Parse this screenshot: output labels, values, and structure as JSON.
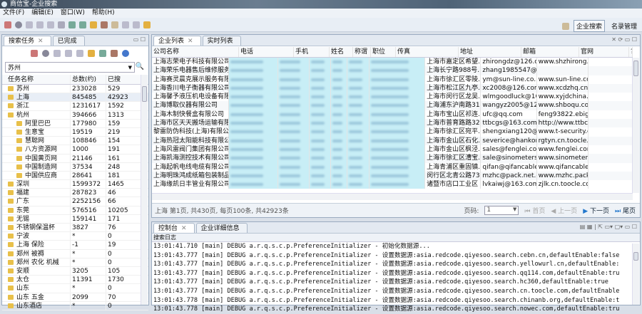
{
  "window": {
    "title": "商信宝-企业搜索"
  },
  "menu": [
    "文件(F)",
    "编辑(E)",
    "窗口(W)",
    "帮助(H)"
  ],
  "perspectives": {
    "search": "企业搜索",
    "list": "名录管理"
  },
  "left": {
    "tabs": [
      "搜索任务",
      "已完成"
    ],
    "search_value": "苏州",
    "columns": [
      "任务名称",
      "总数(约)",
      "已搜"
    ],
    "rows": [
      {
        "name": "苏州",
        "total": "233028",
        "done": "529",
        "sub": false
      },
      {
        "name": "上海",
        "total": "845485",
        "done": "42923",
        "sub": false
      },
      {
        "name": "浙江",
        "total": "1231617",
        "done": "1592",
        "sub": false
      },
      {
        "name": "杭州",
        "total": "394666",
        "done": "1313",
        "sub": false
      },
      {
        "name": "阿里巴巴",
        "total": "177980",
        "done": "159",
        "sub": true
      },
      {
        "name": "生意宝",
        "total": "19519",
        "done": "219",
        "sub": true
      },
      {
        "name": "慧聪网",
        "total": "108846",
        "done": "154",
        "sub": true
      },
      {
        "name": "八方资源网",
        "total": "1000",
        "done": "191",
        "sub": true
      },
      {
        "name": "中国黄页网",
        "total": "21146",
        "done": "161",
        "sub": true
      },
      {
        "name": "中国制造网",
        "total": "37534",
        "done": "248",
        "sub": true
      },
      {
        "name": "中国供应商",
        "total": "28641",
        "done": "181",
        "sub": true
      },
      {
        "name": "深圳",
        "total": "1599372",
        "done": "1465",
        "sub": false
      },
      {
        "name": "福建",
        "total": "287823",
        "done": "46",
        "sub": false
      },
      {
        "name": "广东",
        "total": "2252156",
        "done": "66",
        "sub": false
      },
      {
        "name": "东莞",
        "total": "576516",
        "done": "10205",
        "sub": false
      },
      {
        "name": "无锡",
        "total": "159141",
        "done": "171",
        "sub": false
      },
      {
        "name": "不锈钢保温杯",
        "total": "3827",
        "done": "76",
        "sub": false
      },
      {
        "name": "宁波",
        "total": "*",
        "done": "0",
        "sub": false
      },
      {
        "name": "上海 保险",
        "total": "-1",
        "done": "19",
        "sub": false
      },
      {
        "name": "郑州 被褥",
        "total": "*",
        "done": "0",
        "sub": false
      },
      {
        "name": "郑州 农化 机械",
        "total": "*",
        "done": "0",
        "sub": false
      },
      {
        "name": "安顺",
        "total": "3205",
        "done": "105",
        "sub": false
      },
      {
        "name": "太仓",
        "total": "11391",
        "done": "1730",
        "sub": false
      },
      {
        "name": "山东",
        "total": "*",
        "done": "0",
        "sub": false
      },
      {
        "name": "山东 五金",
        "total": "2099",
        "done": "70",
        "sub": false
      },
      {
        "name": "山东酒店",
        "total": "*",
        "done": "0",
        "sub": false
      }
    ]
  },
  "right": {
    "tabs": [
      "企业列表",
      "实时列表"
    ],
    "columns": [
      "公司名称",
      "电话",
      "手机",
      "姓名",
      "称谓",
      "职位",
      "传真",
      "地址",
      "邮箱",
      "官网",
      "?"
    ],
    "rows": [
      {
        "name": "上海志荣电子科技有限公司",
        "addr": "上海市嘉定区希望...",
        "email": "zhirongdz@126.co...",
        "web": "www.shzhirong.c..."
      },
      {
        "name": "上海荣乐电器售后维修服务公司",
        "addr": "上海长宁路988号...",
        "email": "zhang1985547@12...",
        "web": ""
      },
      {
        "name": "上海赛灵晨克展示服务有限公司",
        "addr": "上海市徐汇区零陵...",
        "email": "ym@sun-line.co...",
        "web": "www.sun-line.co..."
      },
      {
        "name": "上海香川电子衡器有限公司",
        "addr": "上海市松江区九亭...",
        "email": "xc2008@126.com",
        "web": "www.xcdzhq.cn"
      },
      {
        "name": "上海馨予液压机电设备有限公司",
        "addr": "上海市闵行区龙吴...",
        "email": "wlmgoodluck@16...",
        "web": "www.xyjdchina.co..."
      },
      {
        "name": "上海博取仪器有限公司",
        "addr": "上海浦东沪南路31...",
        "email": "wangyz2005@126....",
        "web": "www.shboqu.com"
      },
      {
        "name": "上海木制快餐盒有限公司",
        "addr": "上海市宝山区祁连...",
        "email": "ufc@qq.com",
        "web": "feng93822.ebigchi..."
      },
      {
        "name": "上海市区天天搬场运输有限公司",
        "addr": "上海市普育路路32...",
        "email": "ttbcgs@163.com",
        "web": "http://www.ttbcg..."
      },
      {
        "name": "黎雷防伪科技(上海)有限公司",
        "addr": "上海市徐汇区宛平...",
        "email": "shengxiang120@1...",
        "web": "www.t-security.co..."
      },
      {
        "name": "上海热冠太阳能科技有限公司",
        "addr": "上海市金山区石化...",
        "email": "severice@hankon....",
        "web": "rgtyn.cn.toocle.co..."
      },
      {
        "name": "上海风雷阀门集团有限公司",
        "addr": "上海市金山区枫泾...",
        "email": "sales@fenglei.com",
        "web": "www.fenglei.com"
      },
      {
        "name": "上海凯海测控技术有限公司",
        "addr": "上海市徐汇区漕宝...",
        "email": "sale@sinometers....",
        "web": "www.sinometers.c..."
      },
      {
        "name": "上海起帆电线电缆有限公司",
        "addr": "上海青浦区重固镇...",
        "email": "qifan@qifancable....",
        "web": "www.qifancable.cn"
      },
      {
        "name": "上海明珠鸿成纸箱包装制品有限...",
        "addr": "闵行区北青公路73...",
        "email": "mzhc@pack.net.cn",
        "web": "www.mzhc.pack.cn"
      },
      {
        "name": "上海缘凯日丰管业有限公司",
        "addr": "诸暨市店口工业区",
        "email": "lvkaiwj@163.com",
        "web": "zjlk.cn.toocle.com"
      }
    ],
    "status": "上海 第1页, 共430页, 每页100条, 共42923条",
    "pager": {
      "label": "页码:",
      "page": "1",
      "first": "首页",
      "prev": "上一页",
      "next": "下一页",
      "last": "尾页"
    }
  },
  "console": {
    "tabs": [
      "控制台",
      "企业详细信息"
    ],
    "label": "搜索日志",
    "lines": [
      "13:01:41.710 [main] DEBUG a.r.q.s.c.p.PreferenceInitializer - 初始化数据源...",
      "13:01:43.777 [main] DEBUG a.r.q.s.c.p.PreferenceInitializer - 设置数据源:asia.redcode.qiyesoo.search.cebn.cn,defaultEnable:false",
      "13:01:43.777 [main] DEBUG a.r.q.s.c.p.PreferenceInitializer - 设置数据源:asia.redcode.qiyesoo.search.yellowurl.cn,defaultEnable:",
      "13:01:43.777 [main] DEBUG a.r.q.s.c.p.PreferenceInitializer - 设置数据源:asia.redcode.qiyesoo.search.qq114.com,defaultEnable:tru",
      "13:01:43.777 [main] DEBUG a.r.q.s.c.p.PreferenceInitializer - 设置数据源:asia.redcode.qiyesoo.search.hc360,defaultEnable:true",
      "13:01:43.777 [main] DEBUG a.r.q.s.c.p.PreferenceInitializer - 设置数据源:asia.redcode.qiyesoo.search.cn.toocle.com,defaultEnable",
      "13:01:43.778 [main] DEBUG a.r.q.s.c.p.PreferenceInitializer - 设置数据源:asia.redcode.qiyesoo.search.chinanb.org,defaultEnable:t",
      "13:01:43.778 [main] DEBUG a.r.q.s.c.p.PreferenceInitializer - 设置数据源:asia.redcode.qiyesoo.search.nowec.com,defaultEnable:tru"
    ]
  }
}
